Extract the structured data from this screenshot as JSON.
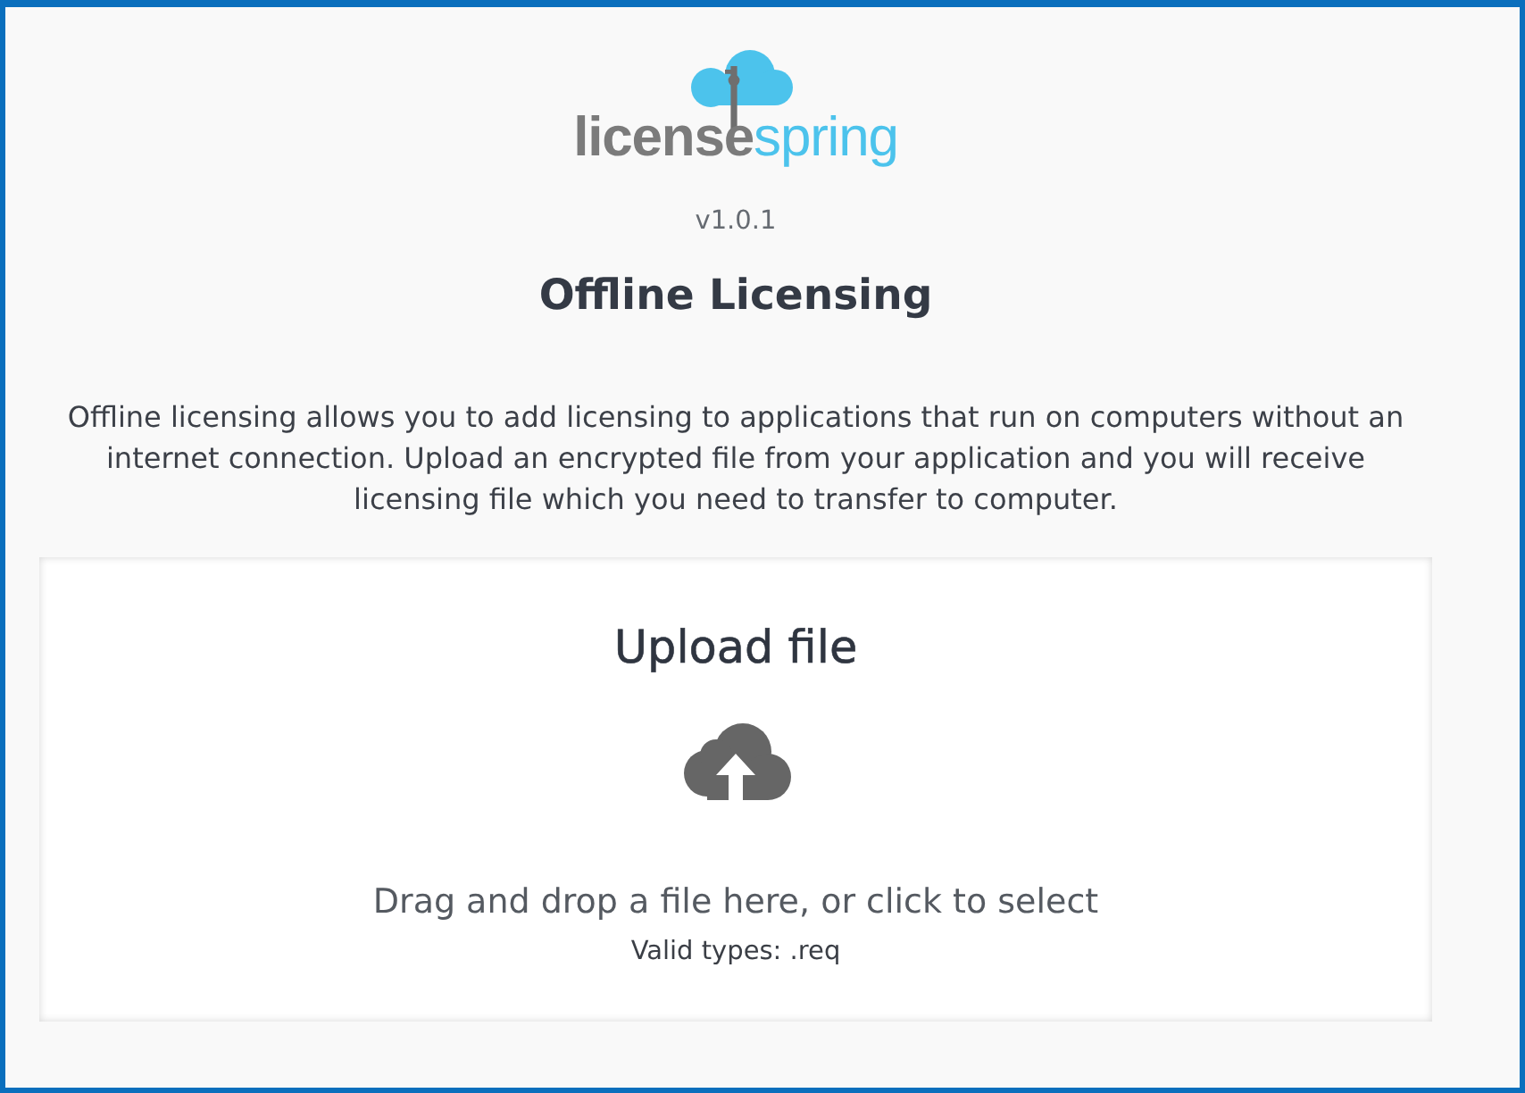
{
  "logo": {
    "word_1": "license",
    "word_2": "spring"
  },
  "version": "v1.0.1",
  "title": "Offline Licensing",
  "description_lines": [
    "Offline licensing allows you to add licensing to applications that run on computers without an",
    "internet connection. Upload an encrypted file from your application and you will receive",
    "licensing file which you need to transfer to computer."
  ],
  "upload": {
    "title": "Upload file",
    "instructions": "Drag and drop a file here, or click to select",
    "valid_types": "Valid types: .req"
  }
}
